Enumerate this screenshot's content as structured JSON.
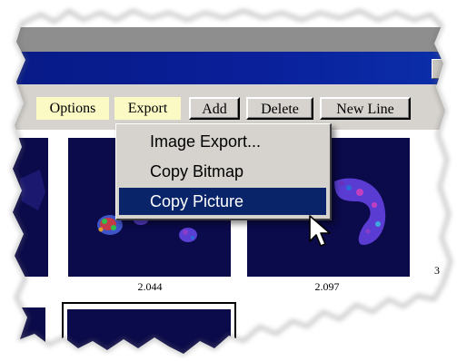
{
  "toolbar": {
    "options_label": "Options",
    "export_label": "Export",
    "add_label": "Add",
    "delete_label": "Delete",
    "new_line_label": "New Line"
  },
  "export_menu": {
    "items": [
      {
        "label": "Image Export..."
      },
      {
        "label": "Copy Bitmap"
      },
      {
        "label": "Copy Picture"
      }
    ],
    "selected_label": "Copy Picture"
  },
  "thumbnails": {
    "labels": [
      "2.044",
      "2.097",
      "3"
    ]
  },
  "colors": {
    "title_bar": "#0a1f9a",
    "panel_background": "#0b0a4a",
    "menu_highlight": "#0a246a",
    "yellow_button": "#fbf9c4"
  },
  "icons": {
    "cursor": "arrow-cursor-icon"
  }
}
